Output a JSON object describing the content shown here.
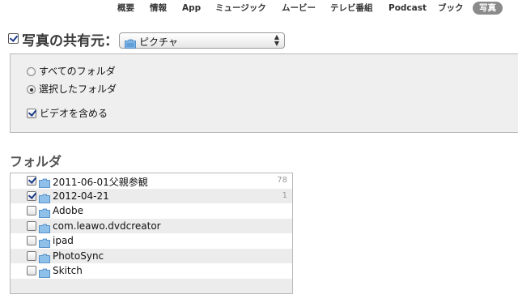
{
  "tabs": [
    {
      "label": "概要",
      "selected": false
    },
    {
      "label": "情報",
      "selected": false
    },
    {
      "label": "App",
      "selected": false
    },
    {
      "label": "ミュージック",
      "selected": false
    },
    {
      "label": "ムービー",
      "selected": false
    },
    {
      "label": "テレビ番組",
      "selected": false
    },
    {
      "label": "Podcast",
      "selected": false
    },
    {
      "label": "ブック",
      "selected": false
    },
    {
      "label": "写真",
      "selected": true
    }
  ],
  "share": {
    "checked": true,
    "title": "写真の共有元：",
    "source_value": "ピクチャ",
    "source_icon": "folder-icon"
  },
  "options": {
    "all_folders_label": "すべてのフォルダ",
    "selected_folders_label": "選択したフォルダ",
    "selected_mode": "selected_folders",
    "include_videos_label": "ビデオを含める",
    "include_videos_checked": true
  },
  "folders": {
    "heading": "フォルダ",
    "items": [
      {
        "name": "2011-06-01父親参観",
        "checked": true,
        "count": "78"
      },
      {
        "name": "2012-04-21",
        "checked": true,
        "count": "1"
      },
      {
        "name": "Adobe",
        "checked": false,
        "count": ""
      },
      {
        "name": "com.leawo.dvdcreator",
        "checked": false,
        "count": ""
      },
      {
        "name": "ipad",
        "checked": false,
        "count": ""
      },
      {
        "name": "PhotoSync",
        "checked": false,
        "count": ""
      },
      {
        "name": "Skitch",
        "checked": false,
        "count": ""
      }
    ]
  },
  "colors": {
    "selected_tab_bg": "#8a8a8a",
    "folder_blue": "#5f9fd6",
    "check_mark": "#1a3a8a"
  }
}
